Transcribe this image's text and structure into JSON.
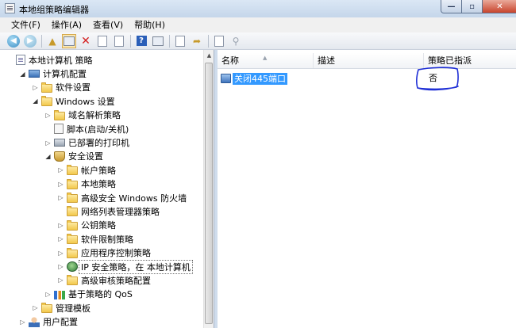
{
  "window": {
    "title": "本地组策略编辑器",
    "controls": {
      "minimize": "—",
      "maximize": "▫",
      "close": "✕"
    }
  },
  "menu": [
    {
      "label": "文件(F)"
    },
    {
      "label": "操作(A)"
    },
    {
      "label": "查看(V)"
    },
    {
      "label": "帮助(H)"
    }
  ],
  "toolbar": {
    "buttons": [
      "back-icon",
      "forward-icon",
      "folder-up-icon",
      "show-hide-tree-icon",
      "delete-icon",
      "properties-icon",
      "export-list-icon",
      "help-icon",
      "show-action-pane-icon",
      "new-policy-icon",
      "assign-policy-icon",
      "manage-filters-icon",
      "unassign-icon"
    ]
  },
  "tree": [
    {
      "label": "本地计算机 策略",
      "level": 0,
      "icon": "policy-doc-icon",
      "toggle": ""
    },
    {
      "label": "计算机配置",
      "level": 1,
      "icon": "computer-icon",
      "toggle": "open"
    },
    {
      "label": "软件设置",
      "level": 2,
      "icon": "folder-icon",
      "toggle": "closed"
    },
    {
      "label": "Windows 设置",
      "level": 2,
      "icon": "folder-icon",
      "toggle": "open"
    },
    {
      "label": "域名解析策略",
      "level": 3,
      "icon": "folder-icon",
      "toggle": "closed"
    },
    {
      "label": "脚本(启动/关机)",
      "level": 3,
      "icon": "script-icon",
      "toggle": ""
    },
    {
      "label": "已部署的打印机",
      "level": 3,
      "icon": "printer-icon",
      "toggle": "closed"
    },
    {
      "label": "安全设置",
      "level": 3,
      "icon": "security-settings-icon",
      "toggle": "open"
    },
    {
      "label": "帐户策略",
      "level": 4,
      "icon": "folder-icon",
      "toggle": "closed"
    },
    {
      "label": "本地策略",
      "level": 4,
      "icon": "folder-icon",
      "toggle": "closed"
    },
    {
      "label": "高级安全 Windows 防火墙",
      "level": 4,
      "icon": "folder-icon",
      "toggle": "closed"
    },
    {
      "label": "网络列表管理器策略",
      "level": 4,
      "icon": "folder-icon",
      "toggle": ""
    },
    {
      "label": "公钥策略",
      "level": 4,
      "icon": "folder-icon",
      "toggle": "closed"
    },
    {
      "label": "软件限制策略",
      "level": 4,
      "icon": "folder-icon",
      "toggle": "closed"
    },
    {
      "label": "应用程序控制策略",
      "level": 4,
      "icon": "folder-icon",
      "toggle": "closed"
    },
    {
      "label": "IP 安全策略，在 本地计算机",
      "level": 4,
      "icon": "ip-security-icon",
      "toggle": "closed",
      "selected": true
    },
    {
      "label": "高级审核策略配置",
      "level": 4,
      "icon": "folder-icon",
      "toggle": "closed"
    },
    {
      "label": "基于策略的 QoS",
      "level": 3,
      "icon": "qos-chart-icon",
      "toggle": "closed"
    },
    {
      "label": "管理模板",
      "level": 2,
      "icon": "folder-icon",
      "toggle": "closed"
    },
    {
      "label": "用户配置",
      "level": 1,
      "icon": "user-icon",
      "toggle": "closed"
    }
  ],
  "list": {
    "columns": {
      "name": "名称",
      "description": "描述",
      "assigned": "策略已指派"
    },
    "rows": [
      {
        "name": "关闭445端口",
        "description": "",
        "assigned": "否",
        "selected": true
      }
    ]
  },
  "annotation": {
    "color": "#1f2fd6"
  }
}
